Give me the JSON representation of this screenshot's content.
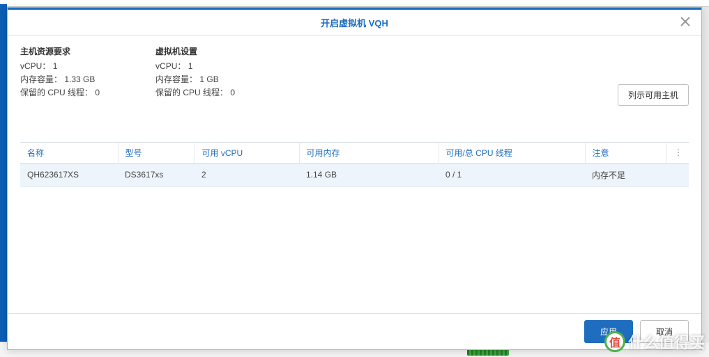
{
  "dialog": {
    "title": "开启虚拟机 VQH",
    "apply_label": "应用",
    "cancel_label": "取消",
    "list_hosts_label": "列示可用主机"
  },
  "host_req": {
    "title": "主机资源要求",
    "vcpu_label": "vCPU：",
    "vcpu_value": "1",
    "mem_label": "内存容量：",
    "mem_value": "1.33 GB",
    "reserved_label": "保留的 CPU 线程：",
    "reserved_value": "0"
  },
  "vm_conf": {
    "title": "虚拟机设置",
    "vcpu_label": "vCPU：",
    "vcpu_value": "1",
    "mem_label": "内存容量：",
    "mem_value": "1 GB",
    "reserved_label": "保留的 CPU 线程：",
    "reserved_value": "0"
  },
  "table": {
    "headers": {
      "name": "名称",
      "model": "型号",
      "avail_vcpu": "可用 vCPU",
      "avail_mem": "可用内存",
      "cpu_threads": "可用/总 CPU 线程",
      "note": "注意"
    },
    "rows": [
      {
        "name": "QH623617XS",
        "model": "DS3617xs",
        "avail_vcpu": "2",
        "avail_mem": "1.14 GB",
        "cpu_threads": "0 / 1",
        "note": "内存不足"
      }
    ]
  },
  "watermark": {
    "logo_char": "值",
    "text": "什么值得买"
  }
}
